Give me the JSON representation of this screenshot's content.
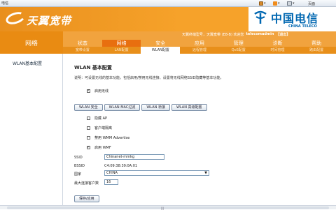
{
  "browser": {
    "title": "电信",
    "toolbar": {
      "home": "",
      "print": "",
      "page": "页面"
    }
  },
  "header": {
    "logo_text": "天翼宽带",
    "brand_cn": "中国电信",
    "brand_en": "CHINA TELECO"
  },
  "userinfo": {
    "text": "天翼终端型号，天翼宽带 (E8-B) 欢迎您",
    "user": "telecomadmin",
    "logout": "【退出】"
  },
  "section": {
    "title": "网络"
  },
  "menu": [
    "状态",
    "网络",
    "安全",
    "应用",
    "管理",
    "诊断",
    "帮助"
  ],
  "submenu": [
    "宽带设置",
    "LAN配置",
    "WLAN配置",
    "远程管理",
    "QoS配置",
    "时间管理",
    "路由配置"
  ],
  "left": {
    "item": "WLAN基本配置"
  },
  "content": {
    "title": "WLAN 基本配置",
    "desc": "说明：可设置无线的基本功能。包括启用/禁用无线连接、设置将无线网络SSID隐藏等基本功能。",
    "enable_wireless": {
      "label": "启用无线",
      "checked": true
    },
    "buttons": [
      "WLAN 安全",
      "WLAN MAC过滤",
      "WLAN 桥接",
      "WLAN 高级配置"
    ],
    "options": [
      {
        "label": "隐藏  AP",
        "checked": false
      },
      {
        "label": "客户端隔离",
        "checked": false
      },
      {
        "label": "禁用  WMM Advertise",
        "checked": false
      },
      {
        "label": "启用  WMF",
        "checked": true
      }
    ],
    "ssid_label": "SSID",
    "ssid_value": "Chinanet-mmkg",
    "bssid_label": "BSSID",
    "bssid_value": "C4:09:38:39:0A:01",
    "country_label": "国家",
    "country_value": "CHINA",
    "max_clients_label": "最大连接客户数",
    "max_clients_value": "16",
    "save_label": "保存/应用"
  }
}
